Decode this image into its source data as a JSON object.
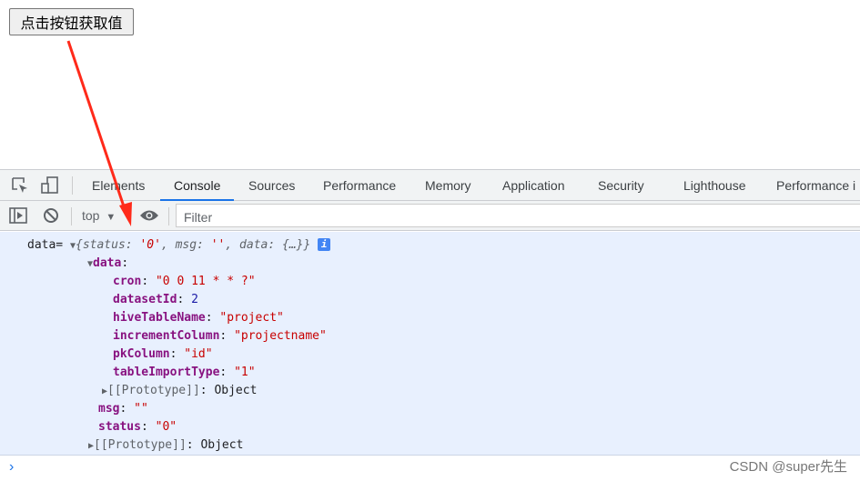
{
  "page": {
    "button_label": "点击按钮获取值"
  },
  "devtools": {
    "tabs": [
      "Elements",
      "Console",
      "Sources",
      "Performance",
      "Memory",
      "Application",
      "Security",
      "Lighthouse",
      "Performance i"
    ],
    "active_tab": "Console",
    "context": "top",
    "filter_placeholder": "Filter"
  },
  "console": {
    "label": "data=",
    "summary": {
      "status_key": "status",
      "status_val": "'0'",
      "msg_key": "msg",
      "msg_val": "''",
      "data_key": "data",
      "data_val": "{…}"
    },
    "data_key": "data",
    "fields": [
      {
        "key": "cron",
        "value": "\"0 0 11 * * ?\"",
        "type": "str"
      },
      {
        "key": "datasetId",
        "value": "2",
        "type": "num"
      },
      {
        "key": "hiveTableName",
        "value": "\"project\"",
        "type": "str"
      },
      {
        "key": "incrementColumn",
        "value": "\"projectname\"",
        "type": "str"
      },
      {
        "key": "pkColumn",
        "value": "\"id\"",
        "type": "str"
      },
      {
        "key": "tableImportType",
        "value": "\"1\"",
        "type": "str"
      }
    ],
    "prototype_key": "[[Prototype]]",
    "prototype_val": "Object",
    "msg_key": "msg",
    "msg_val": "\"\"",
    "status_key": "status",
    "status_val": "\"0\""
  },
  "watermark": "CSDN @super先生",
  "colors": {
    "accent": "#1a73e8",
    "arrow": "#ff2a1a",
    "log_bg": "#e8f0fe"
  }
}
